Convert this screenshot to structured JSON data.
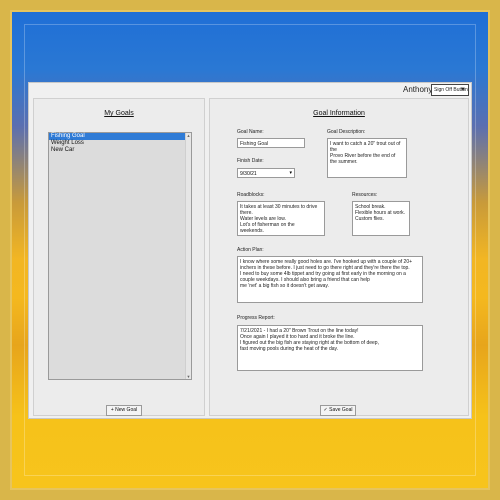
{
  "header": {
    "username": "Anthony",
    "user_menu_value": "Sign Off Button"
  },
  "left_panel": {
    "title": "My Goals",
    "goals": [
      "Fishing Goal",
      "Weight Loss",
      "New Car"
    ],
    "selected_index": 0,
    "new_goal_label": "+ New Goal"
  },
  "right_panel": {
    "title": "Goal Information",
    "goal_name_label": "Goal Name:",
    "goal_name_value": "Fishing Goal",
    "finish_date_label": "Finish Date:",
    "finish_date_value": "9/30/21",
    "goal_description_label": "Goal Description:",
    "goal_description_value": "I want to catch a 20\" trout out of the\nProvo River before the end of\nthe summer.",
    "roadblocks_label": "Roadblocks:",
    "roadblocks_value": "It takes at least 30 minutes to drive\nthere.\nWater levels are low.\nLot's of fisherman on the\nweekends.",
    "resources_label": "Resources:",
    "resources_value": "School break.\nFlexible hours at work.\nCustom flies.",
    "action_plan_label": "Action Plan:",
    "action_plan_value": "I know where some really good holes are. I've hooked up with a couple of 20+\ninchers in these before. I just need to go there right and they're there the top.\nI need to buy some 4lb tippet and try going at first early in the morning on a\ncouple weekdays. I should also bring a friend that can help\nme 'net' a big fish so it doesn't get away.",
    "progress_label": "Progress Report:",
    "progress_value": "7/21/2021 - I had a 20\" Brown Trout on the line today!\nOnce again I played it too hard and it broke the line.\nI figured out the big fish are staying right at the bottom of deep,\nfast moving pools during the heat of the day.",
    "save_goal_label": "✓ Save Goal"
  }
}
